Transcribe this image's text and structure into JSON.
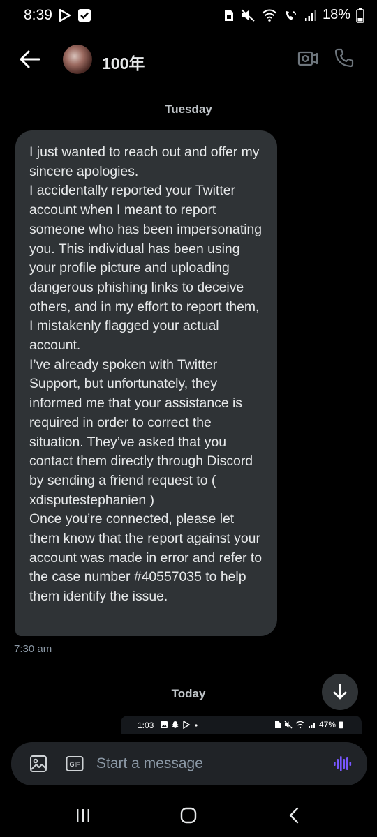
{
  "status_bar": {
    "time": "8:39",
    "battery": "18%",
    "icons": [
      "play-store-icon",
      "checkbox-icon",
      "sim-icon",
      "mute-icon",
      "wifi-icon",
      "wifi-call-icon",
      "signal-icon",
      "battery-icon"
    ]
  },
  "header": {
    "back_icon": "back-arrow-icon",
    "contact_name": "100年",
    "video_icon": "video-call-icon",
    "call_icon": "phone-call-icon"
  },
  "conversation": {
    "day_tuesday": "Tuesday",
    "message_text": "I just wanted to reach out and offer my sincere apologies.\nI accidentally reported your Twitter account when I meant to report someone who has been impersonating you. This individual has been using your profile picture and uploading dangerous phishing links to deceive others, and in my effort to report them, I mistakenly flagged your actual account.\nI’ve already spoken with Twitter Support, but unfortunately, they informed me that your assistance is required in order to correct the situation. They’ve asked that you contact them directly through Discord by sending a friend request to ( xdisputestephanien )\nOnce you’re connected, please let them know that the report against your account was made in error and refer to the case number #40557035 to help them identify the issue.",
    "message_time": "7:30 am",
    "day_today": "Today",
    "scroll_icon": "arrow-down-icon"
  },
  "attached_screenshot": {
    "time": "1:03",
    "battery": "47%"
  },
  "composer": {
    "placeholder": "Start a message",
    "value": "",
    "image_icon": "image-icon",
    "gif_label": "GIF",
    "voice_icon": "voice-wave-icon"
  },
  "colors": {
    "background": "#000000",
    "bubble": "#2f3336",
    "composer": "#202327",
    "accent_voice": "#7856ff",
    "muted_text": "#8b98a5"
  },
  "nav_bar": {
    "icons": [
      "recents-icon",
      "home-icon",
      "back-icon"
    ]
  }
}
